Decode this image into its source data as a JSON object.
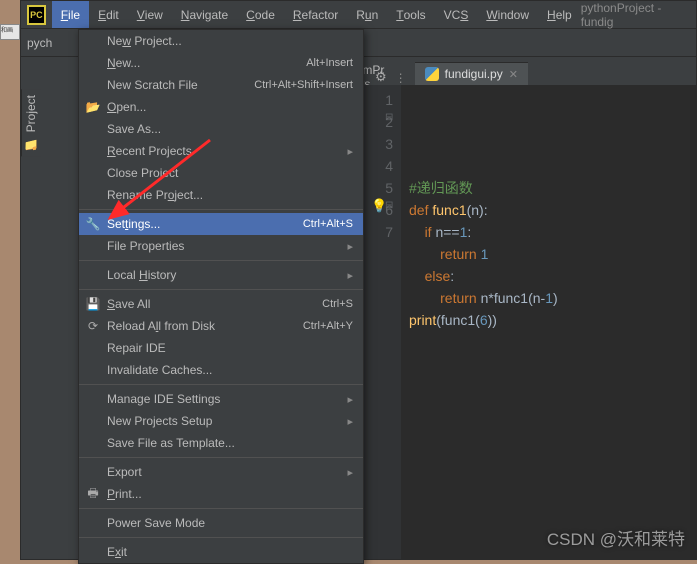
{
  "window": {
    "project_label": "pythonProject - fundig"
  },
  "menubar": {
    "items": [
      {
        "label": "File",
        "u": 0,
        "open": true
      },
      {
        "label": "Edit",
        "u": 0
      },
      {
        "label": "View",
        "u": 0
      },
      {
        "label": "Navigate",
        "u": 0
      },
      {
        "label": "Code",
        "u": 0
      },
      {
        "label": "Refactor",
        "u": 0
      },
      {
        "label": "Run",
        "u": 1
      },
      {
        "label": "Tools",
        "u": 0
      },
      {
        "label": "VCS",
        "u": 2
      },
      {
        "label": "Window",
        "u": 0
      },
      {
        "label": "Help",
        "u": 0
      }
    ]
  },
  "breadcrumb": {
    "root": "pych",
    "hidden_parent": "harmPr",
    "hidden_parent2": "cts"
  },
  "sidebar": {
    "tab_label": "Project"
  },
  "file_menu": {
    "groups": [
      [
        {
          "label": "New Project...",
          "ul": 2
        },
        {
          "label": "New...",
          "ul": 0,
          "shortcut": "Alt+Insert"
        },
        {
          "label": "New Scratch File",
          "shortcut": "Ctrl+Alt+Shift+Insert"
        },
        {
          "label": "Open...",
          "ul": 0,
          "icon": "folder"
        },
        {
          "label": "Save As..."
        },
        {
          "label": "Recent Projects",
          "ul": 0,
          "submenu": true
        },
        {
          "label": "Close Project"
        },
        {
          "label": "Rename Project...",
          "ul": 9
        }
      ],
      [
        {
          "label": "Settings...",
          "ul": 3,
          "shortcut": "Ctrl+Alt+S",
          "icon": "wrench",
          "selected": true
        },
        {
          "label": "File Properties",
          "submenu": true
        }
      ],
      [
        {
          "label": "Local History",
          "ul": 6,
          "submenu": true
        }
      ],
      [
        {
          "label": "Save All",
          "ul": 0,
          "shortcut": "Ctrl+S",
          "icon": "save"
        },
        {
          "label": "Reload All from Disk",
          "ul": 8,
          "shortcut": "Ctrl+Alt+Y",
          "icon": "reload"
        },
        {
          "label": "Repair IDE"
        },
        {
          "label": "Invalidate Caches..."
        }
      ],
      [
        {
          "label": "Manage IDE Settings",
          "submenu": true
        },
        {
          "label": "New Projects Setup",
          "submenu": true
        },
        {
          "label": "Save File as Template..."
        }
      ],
      [
        {
          "label": "Export",
          "submenu": true
        },
        {
          "label": "Print...",
          "ul": 0,
          "icon": "print"
        }
      ],
      [
        {
          "label": "Power Save Mode"
        }
      ],
      [
        {
          "label": "Exit",
          "ul": 1
        }
      ]
    ]
  },
  "tabs": {
    "active": {
      "name": "fundigui.py"
    }
  },
  "code": {
    "lines": [
      {
        "n": 1,
        "html": "<span class='cm'>#递归函数</span>"
      },
      {
        "n": 2,
        "html": "<span class='kw'>def</span> <span class='fn'>func1</span>(n):"
      },
      {
        "n": 3,
        "html": "    <span class='kw'>if</span> n==<span class='num'>1</span>:"
      },
      {
        "n": 4,
        "html": "        <span class='kw'>return</span> <span class='num'>1</span>"
      },
      {
        "n": 5,
        "html": "    <span class='kw'>else</span>:"
      },
      {
        "n": 6,
        "html": "        <span class='kw'>return</span> n*func1(n-<span class='num'>1</span>)"
      },
      {
        "n": 7,
        "html": "<span class='fn'>print</span>(func1(<span class='num'>6</span>))"
      }
    ]
  },
  "watermark": "CSDN @沃和莱特"
}
